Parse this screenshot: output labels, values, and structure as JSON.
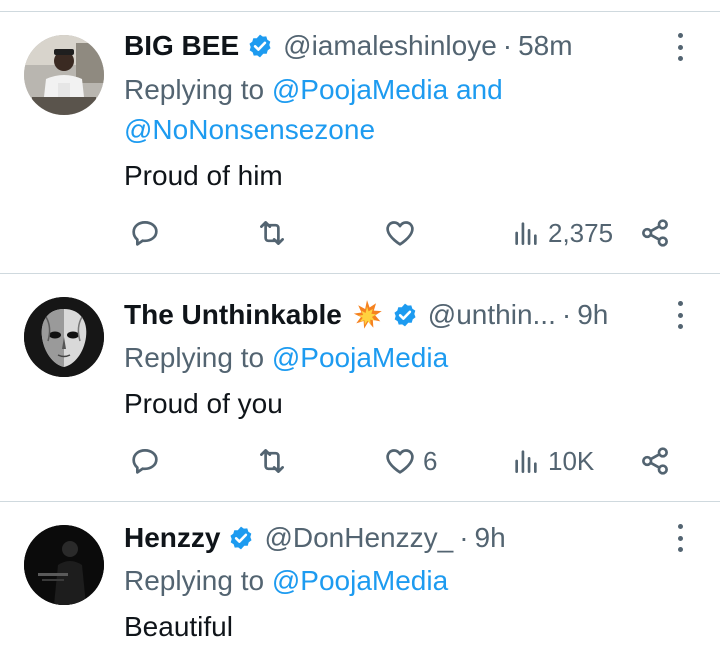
{
  "tweets": [
    {
      "name": "BIG BEE",
      "handle": "@iamaleshinloye",
      "time": "58m",
      "replying_prefix": "Replying to ",
      "replying_line1": "@PoojaMedia and",
      "replying_line2": "@NoNonsensezone",
      "text": "Proud of him",
      "likes": "",
      "views": "2,375"
    },
    {
      "name": "The Unthinkable",
      "emoji": "collision-emoji",
      "handle": "@unthin...",
      "time": "9h",
      "replying_prefix": "Replying to ",
      "replying_line1": "@PoojaMedia",
      "text": "Proud of you",
      "likes": "6",
      "views": "10K"
    },
    {
      "name": "Henzzy",
      "handle": "@DonHenzzy_",
      "time": "9h",
      "replying_prefix": "Replying to ",
      "replying_line1": "@PoojaMedia",
      "text": "Beautiful"
    }
  ],
  "separator": "·",
  "colors": {
    "verified": "#1d9bf0",
    "mention": "#1d9bf0",
    "secondary": "#536471",
    "primary": "#0f1419",
    "divider": "#cfd9de"
  },
  "icons": [
    "verified-badge-icon",
    "reply-icon",
    "retweet-icon",
    "like-icon",
    "views-icon",
    "share-icon",
    "more-icon"
  ]
}
